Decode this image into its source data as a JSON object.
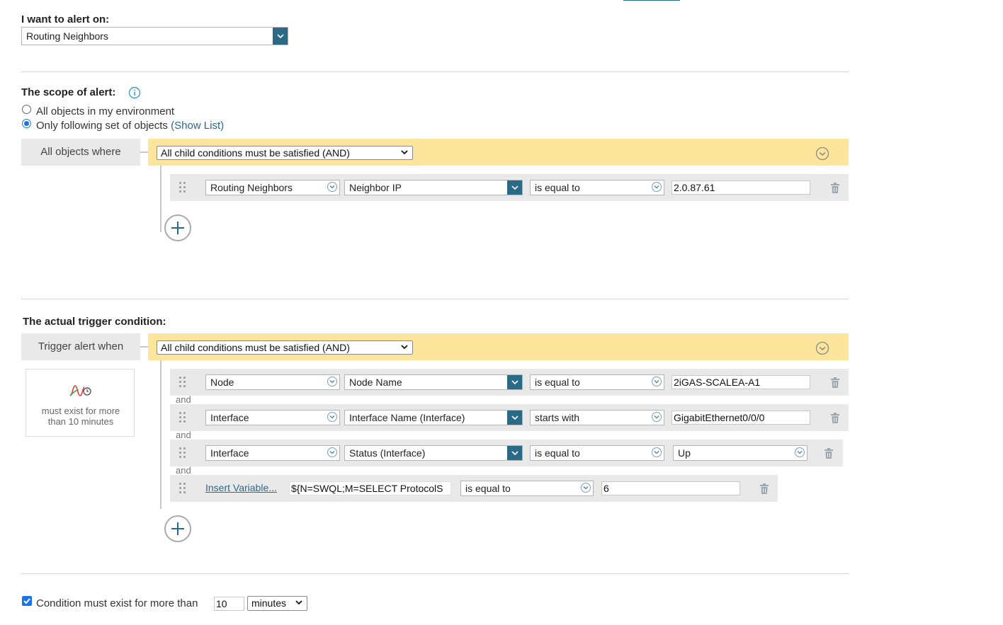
{
  "alert_on": {
    "label": "I want to alert on:",
    "value": "Routing Neighbors"
  },
  "scope": {
    "title": "The scope of alert:",
    "radio_all_label": "All objects in my environment",
    "radio_some_label": "Only following set of objects",
    "show_list_link": "(Show List)",
    "selected": "some",
    "box_label": "All objects where",
    "group_select": "All child conditions must be satisfied (AND)",
    "condition": {
      "object": "Routing Neighbors",
      "property": "Neighbor IP",
      "operator": "is equal to",
      "value": "2.0.87.61"
    }
  },
  "trigger": {
    "title": "The actual trigger condition:",
    "box_label": "Trigger alert when",
    "group_select": "All child conditions must be satisfied (AND)",
    "duration_note": "must exist for more than 10 minutes",
    "and_label": "and",
    "conditions": [
      {
        "object": "Node",
        "property": "Node Name",
        "operator": "is equal to",
        "value": "2iGAS-SCALEA-A1"
      },
      {
        "object": "Interface",
        "property": "Interface Name (Interface)",
        "operator": "starts with",
        "value": "GigabitEthernet0/0/0"
      },
      {
        "object": "Interface",
        "property": "Status (Interface)",
        "operator": "is equal to",
        "value": "Up"
      },
      {
        "insert_variable_link": "Insert Variable...",
        "variable": "${N=SWQL;M=SELECT ProtocolS",
        "operator": "is equal to",
        "value": "6"
      }
    ]
  },
  "footer": {
    "checkbox_label": "Condition must exist for more than",
    "minutes_value": "10",
    "unit": "minutes",
    "checked": true
  },
  "colors": {
    "accent_dark": "#2b6a86",
    "group_bar": "#fde69c",
    "link_blue": "#1a73e8"
  }
}
